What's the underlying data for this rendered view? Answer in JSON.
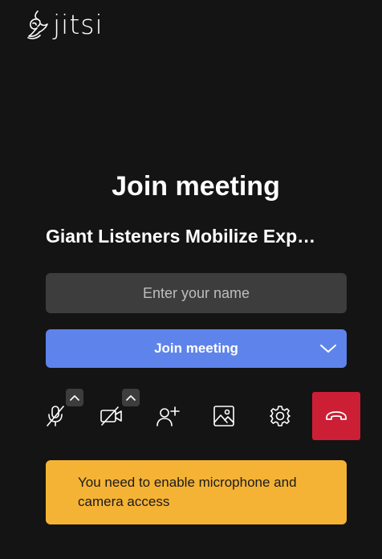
{
  "brand": {
    "logo_text": "jitsi",
    "logo_icon": "jitsi-bird-icon"
  },
  "prejoin": {
    "title": "Join meeting",
    "meeting_name": "Giant Listeners Mobilize Exp…",
    "name_input": {
      "placeholder": "Enter your name",
      "value": ""
    },
    "join_button": {
      "label": "Join meeting",
      "icon": "chevron-down-icon"
    }
  },
  "toolbar": {
    "buttons": [
      {
        "name": "microphone",
        "icon": "microphone-off-icon",
        "has_options_arrow": true
      },
      {
        "name": "camera",
        "icon": "camera-off-icon",
        "has_options_arrow": true
      },
      {
        "name": "invite",
        "icon": "add-person-icon"
      },
      {
        "name": "background",
        "icon": "image-icon"
      },
      {
        "name": "settings",
        "icon": "gear-icon"
      },
      {
        "name": "hangup",
        "icon": "phone-hangup-icon"
      }
    ]
  },
  "warning": {
    "text": "You need to enable microphone and camera access"
  },
  "colors": {
    "background": "#141414",
    "input_background": "#3d3d3d",
    "primary": "#5e84eb",
    "hangup": "#cc1f35",
    "warning": "#f5b335"
  }
}
